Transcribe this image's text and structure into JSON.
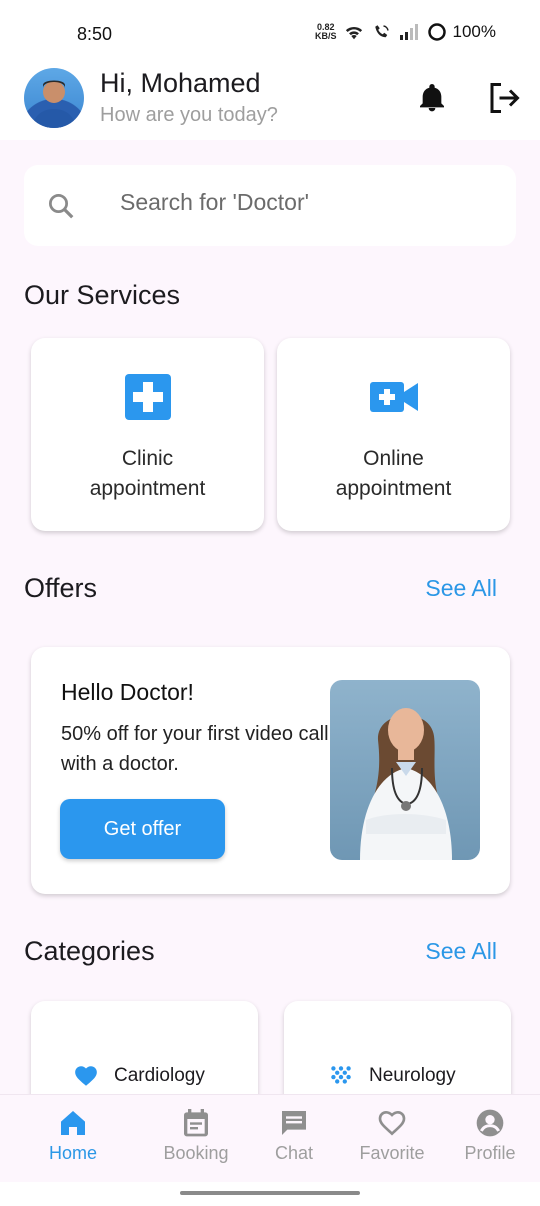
{
  "status_bar": {
    "time": "8:50",
    "net_speed_value": "0.82",
    "net_speed_unit": "KB/S",
    "battery": "100%"
  },
  "header": {
    "greeting": "Hi, Mohamed",
    "subtitle": "How are you today?"
  },
  "search": {
    "placeholder": "Search for 'Doctor'"
  },
  "services": {
    "title": "Our Services",
    "items": [
      {
        "label": "Clinic\nappointment",
        "icon": "medical-cross-icon"
      },
      {
        "label": "Online\nappointment",
        "icon": "video-call-icon"
      }
    ]
  },
  "offers": {
    "title": "Offers",
    "see_all": "See All",
    "card": {
      "title": "Hello Doctor!",
      "description": "50% off for your first video call with a doctor.",
      "button": "Get offer"
    }
  },
  "categories": {
    "title": "Categories",
    "see_all": "See All",
    "items": [
      {
        "label": "Cardiology",
        "icon": "heart-icon"
      },
      {
        "label": "Neurology",
        "icon": "neurology-dots-icon"
      }
    ]
  },
  "bottom_nav": {
    "items": [
      {
        "label": "Home",
        "icon": "home-icon",
        "active": true
      },
      {
        "label": "Booking",
        "icon": "calendar-icon",
        "active": false
      },
      {
        "label": "Chat",
        "icon": "chat-icon",
        "active": false
      },
      {
        "label": "Favorite",
        "icon": "heart-outline-icon",
        "active": false
      },
      {
        "label": "Profile",
        "icon": "profile-icon",
        "active": false
      }
    ]
  },
  "colors": {
    "accent": "#2b97e6",
    "background": "#fdf6fd",
    "card": "#ffffff",
    "inactive": "#9e9e9e"
  }
}
